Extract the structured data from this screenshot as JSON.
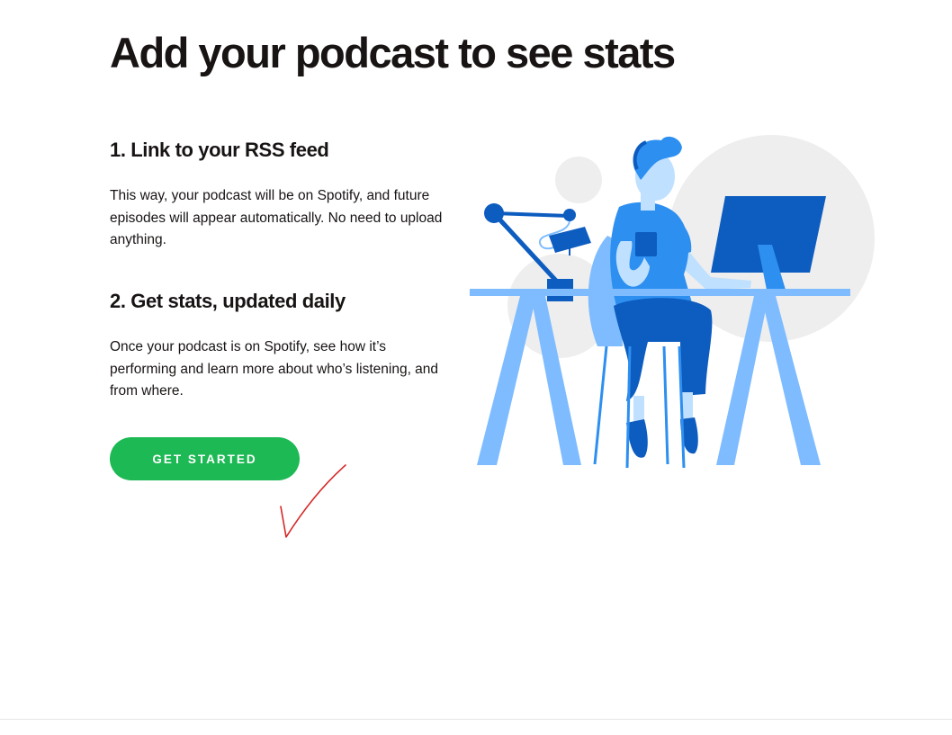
{
  "page": {
    "title": "Add your podcast to see stats"
  },
  "steps": [
    {
      "heading": "1. Link to your RSS feed",
      "body": "This way, your podcast will be on Spotify, and future episodes will appear automatically. No need to upload anything."
    },
    {
      "heading": "2. Get stats, updated daily",
      "body": "Once your podcast is on Spotify, see how it’s performing and learn more about who’s listening, and from where."
    }
  ],
  "cta": {
    "label": "GET STARTED"
  },
  "colors": {
    "brand_green": "#1db954",
    "text": "#191414",
    "illustration_dark_blue": "#0d5cbf",
    "illustration_mid_blue": "#2d8ff0",
    "illustration_light_blue": "#7ebcff",
    "background_circle": "#eeeeee",
    "annotation_red": "#d62828"
  },
  "icons": {
    "illustration": "podcaster-at-desk-illustration",
    "annotation": "red-check-mark-icon"
  }
}
